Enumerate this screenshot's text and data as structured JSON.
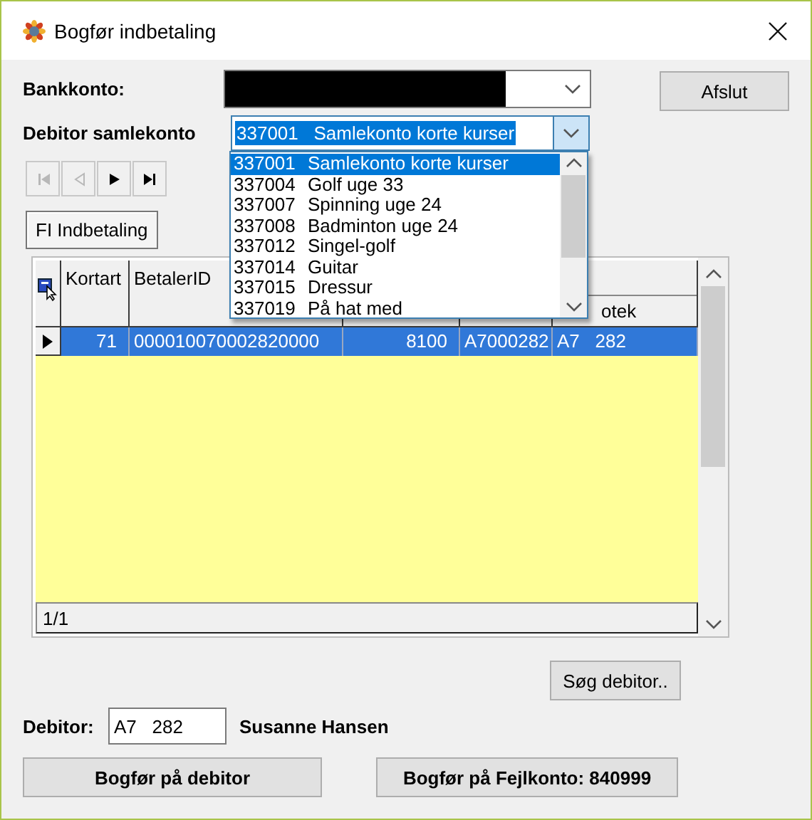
{
  "window": {
    "title": "Bogfør indbetaling"
  },
  "bankkonto": {
    "label": "Bankkonto:"
  },
  "afslut_button": "Afslut",
  "debitor_samlekonto": {
    "label": "Debitor samlekonto",
    "value": "337001   Samlekonto korte kurser",
    "expanded": true,
    "options": [
      {
        "code": "337001",
        "name": "Samlekonto korte kurser",
        "selected": true
      },
      {
        "code": "337004",
        "name": "Golf uge 33",
        "selected": false
      },
      {
        "code": "337007",
        "name": "Spinning uge 24",
        "selected": false
      },
      {
        "code": "337008",
        "name": "Badminton uge 24",
        "selected": false
      },
      {
        "code": "337012",
        "name": "Singel-golf",
        "selected": false
      },
      {
        "code": "337014",
        "name": "Guitar",
        "selected": false
      },
      {
        "code": "337015",
        "name": "Dressur",
        "selected": false
      },
      {
        "code": "337019",
        "name": "På hat med",
        "selected": false
      }
    ]
  },
  "navigator": [
    {
      "kind": "first",
      "disabled": true
    },
    {
      "kind": "prior",
      "disabled": true
    },
    {
      "kind": "next",
      "disabled": false
    },
    {
      "kind": "last",
      "disabled": false
    }
  ],
  "tabs": [
    {
      "label": "FI Indbetaling",
      "selected": true
    }
  ],
  "grid": {
    "headers": [
      "Kortart",
      "BetalerID"
    ],
    "column_6_header": "otek",
    "rows": [
      {
        "selected": true,
        "cells": [
          "71",
          "000010070002820000",
          "8100",
          "A7000282",
          "A7   282"
        ]
      }
    ],
    "record_counter": "1/1"
  },
  "search_button": "Søg debitor..",
  "debitor": {
    "label": "Debitor:",
    "value": "A7   282",
    "name": "Susanne Hansen"
  },
  "buttons": [
    "Bogfør på debitor",
    "Bogfør på Fejlkonto: 840999"
  ]
}
